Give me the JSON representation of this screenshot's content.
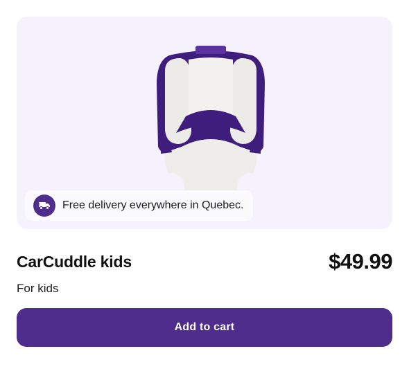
{
  "product": {
    "name": "CarCuddle kids",
    "price": "$49.99",
    "subtitle": "For kids",
    "image_icon": "car-seat-cushion"
  },
  "delivery": {
    "text": "Free delivery everywhere in Quebec.",
    "icon": "delivery-truck-icon"
  },
  "actions": {
    "add_to_cart_label": "Add to cart"
  },
  "colors": {
    "accent": "#4f2d8c",
    "panel_background": "#f5f1fd"
  }
}
